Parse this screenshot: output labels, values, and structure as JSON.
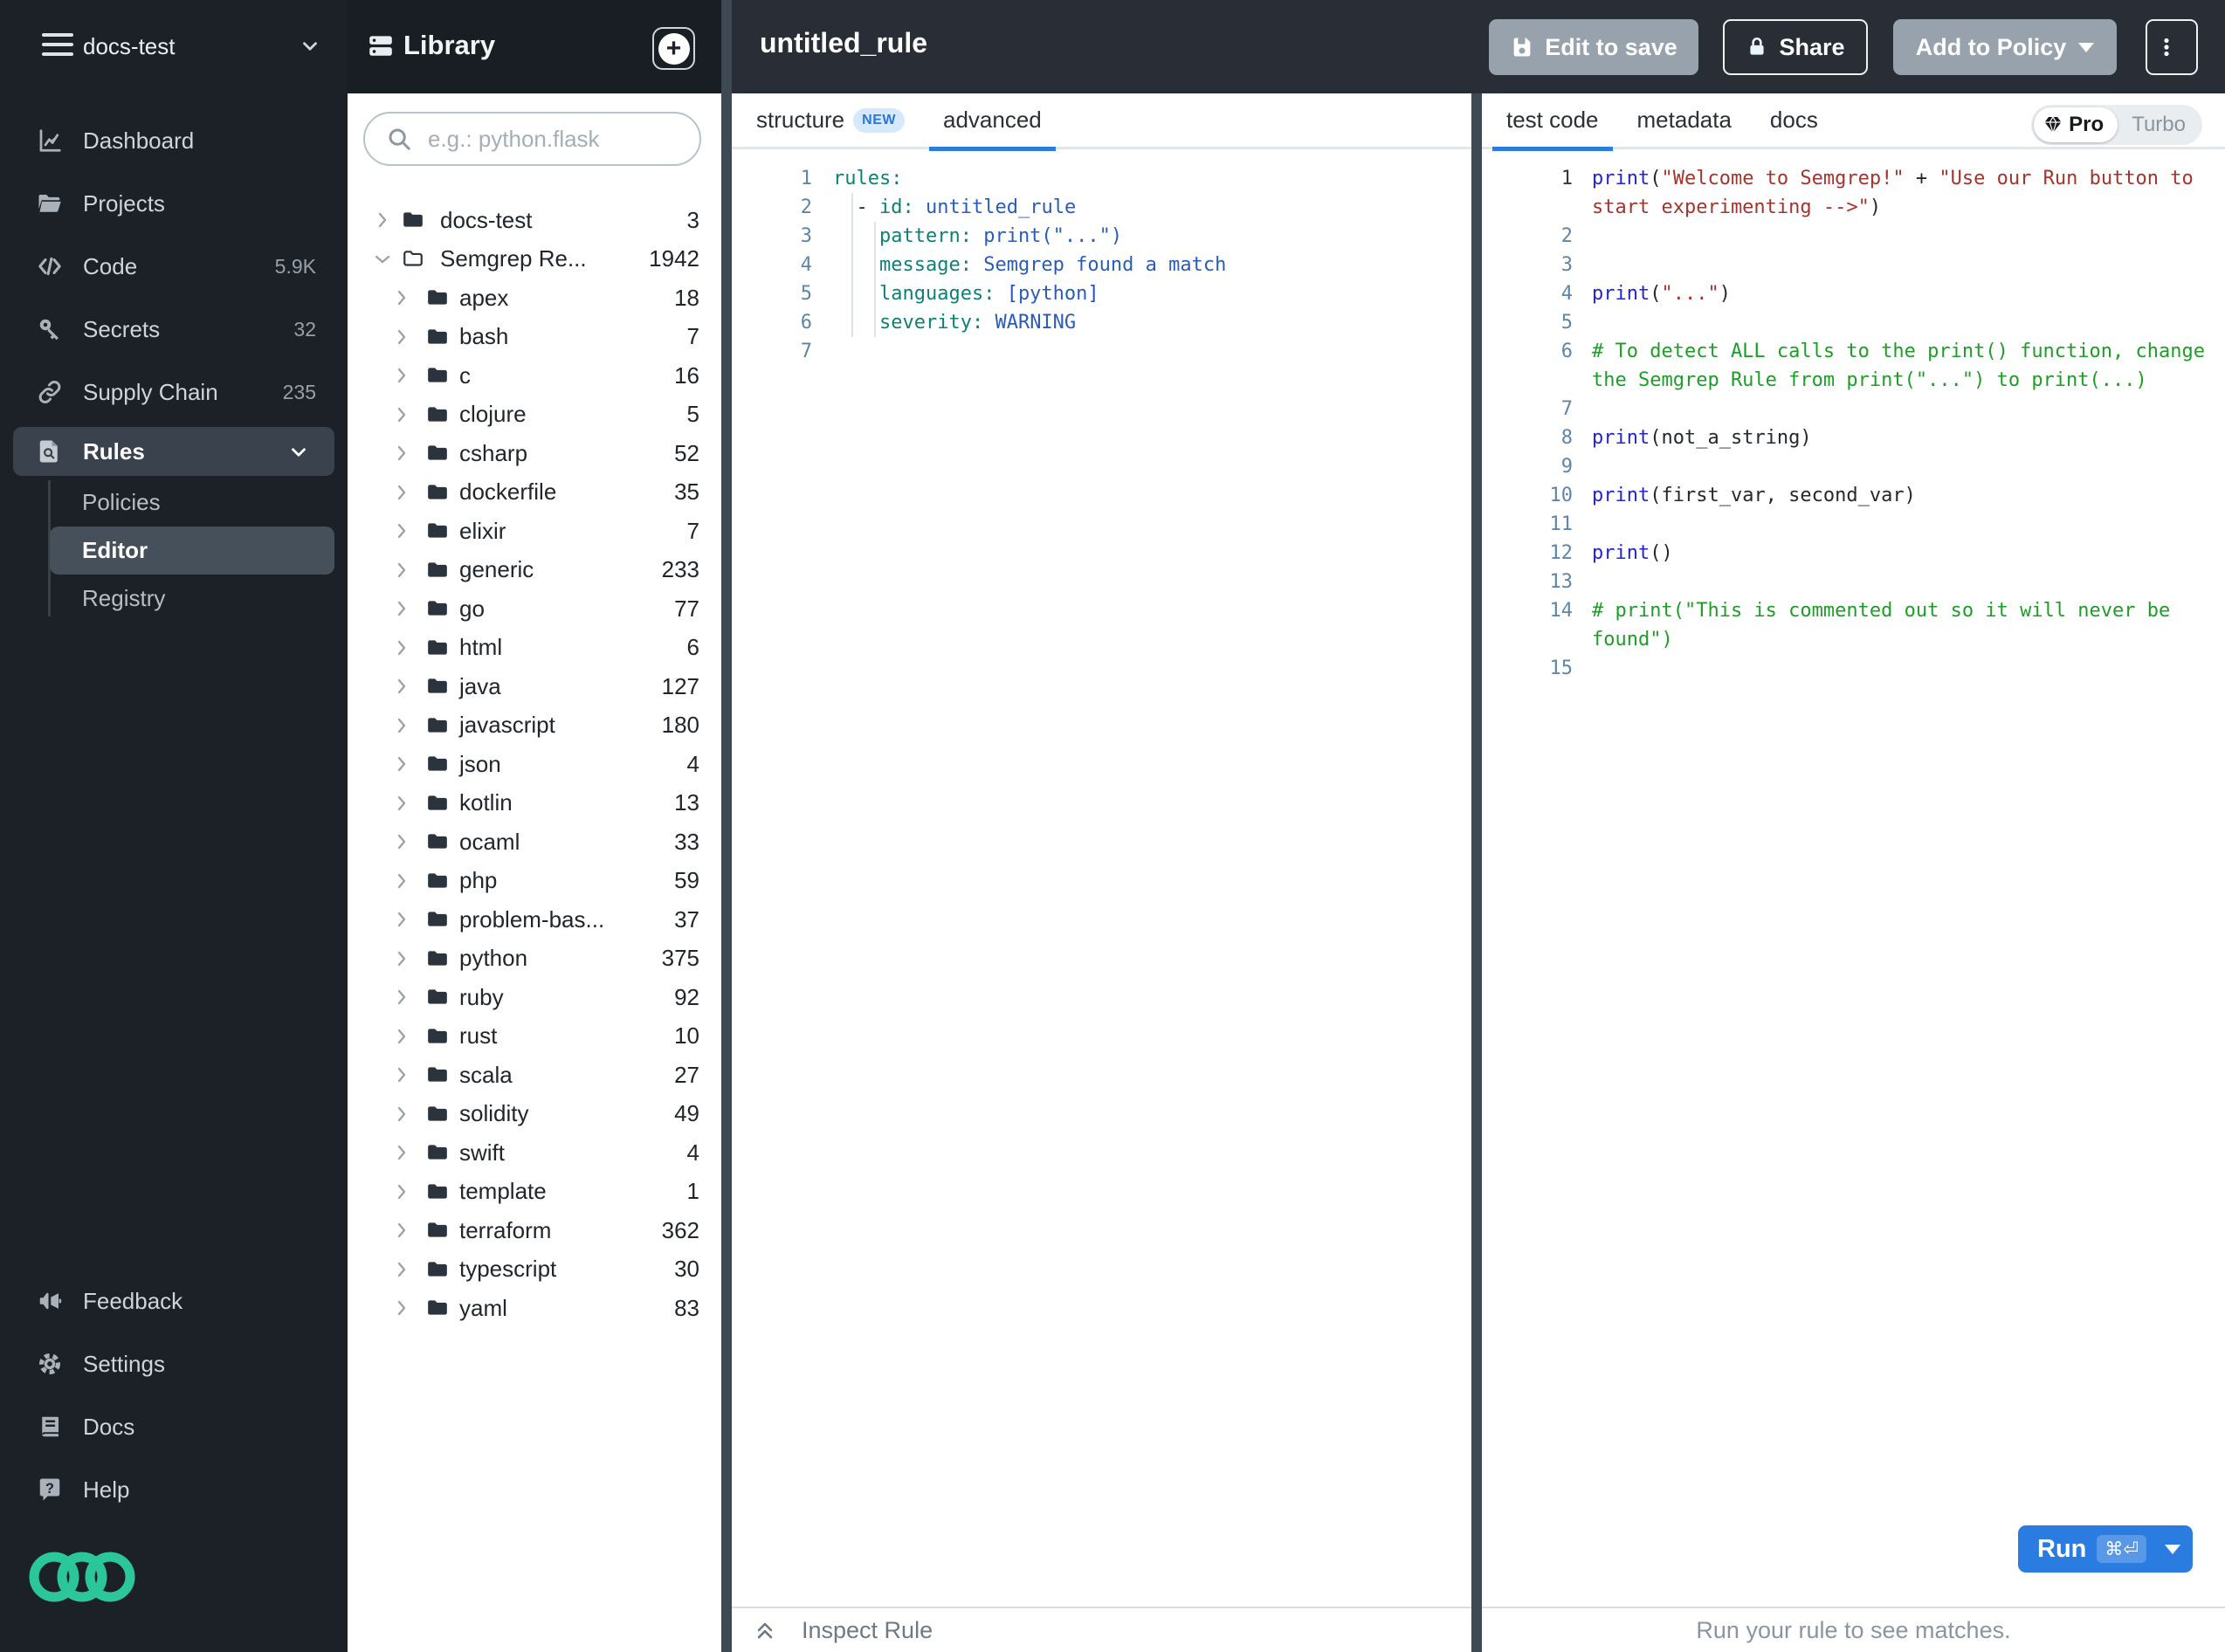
{
  "workspace": {
    "name": "docs-test"
  },
  "sidebar": {
    "nav": [
      {
        "label": "Dashboard"
      },
      {
        "label": "Projects"
      },
      {
        "label": "Code",
        "count": "5.9K"
      },
      {
        "label": "Secrets",
        "count": "32"
      },
      {
        "label": "Supply Chain",
        "count": "235"
      },
      {
        "label": "Rules"
      }
    ],
    "rules_children": [
      {
        "label": "Policies"
      },
      {
        "label": "Editor"
      },
      {
        "label": "Registry"
      }
    ],
    "bottom": [
      {
        "label": "Feedback"
      },
      {
        "label": "Settings"
      },
      {
        "label": "Docs"
      },
      {
        "label": "Help"
      }
    ]
  },
  "library": {
    "title": "Library",
    "search_placeholder": "e.g.: python.flask",
    "tree": [
      {
        "name": "docs-test",
        "count": "3",
        "depth": 0,
        "state": "collapsed",
        "folder": "filled"
      },
      {
        "name": "Semgrep Re...",
        "count": "1942",
        "depth": 0,
        "state": "expanded",
        "folder": "outline"
      },
      {
        "name": "apex",
        "count": "18",
        "depth": 1,
        "state": "collapsed",
        "folder": "filled"
      },
      {
        "name": "bash",
        "count": "7",
        "depth": 1,
        "state": "collapsed",
        "folder": "filled"
      },
      {
        "name": "c",
        "count": "16",
        "depth": 1,
        "state": "collapsed",
        "folder": "filled"
      },
      {
        "name": "clojure",
        "count": "5",
        "depth": 1,
        "state": "collapsed",
        "folder": "filled"
      },
      {
        "name": "csharp",
        "count": "52",
        "depth": 1,
        "state": "collapsed",
        "folder": "filled"
      },
      {
        "name": "dockerfile",
        "count": "35",
        "depth": 1,
        "state": "collapsed",
        "folder": "filled"
      },
      {
        "name": "elixir",
        "count": "7",
        "depth": 1,
        "state": "collapsed",
        "folder": "filled"
      },
      {
        "name": "generic",
        "count": "233",
        "depth": 1,
        "state": "collapsed",
        "folder": "filled"
      },
      {
        "name": "go",
        "count": "77",
        "depth": 1,
        "state": "collapsed",
        "folder": "filled"
      },
      {
        "name": "html",
        "count": "6",
        "depth": 1,
        "state": "collapsed",
        "folder": "filled"
      },
      {
        "name": "java",
        "count": "127",
        "depth": 1,
        "state": "collapsed",
        "folder": "filled"
      },
      {
        "name": "javascript",
        "count": "180",
        "depth": 1,
        "state": "collapsed",
        "folder": "filled"
      },
      {
        "name": "json",
        "count": "4",
        "depth": 1,
        "state": "collapsed",
        "folder": "filled"
      },
      {
        "name": "kotlin",
        "count": "13",
        "depth": 1,
        "state": "collapsed",
        "folder": "filled"
      },
      {
        "name": "ocaml",
        "count": "33",
        "depth": 1,
        "state": "collapsed",
        "folder": "filled"
      },
      {
        "name": "php",
        "count": "59",
        "depth": 1,
        "state": "collapsed",
        "folder": "filled"
      },
      {
        "name": "problem-bas...",
        "count": "37",
        "depth": 1,
        "state": "collapsed",
        "folder": "filled"
      },
      {
        "name": "python",
        "count": "375",
        "depth": 1,
        "state": "collapsed",
        "folder": "filled"
      },
      {
        "name": "ruby",
        "count": "92",
        "depth": 1,
        "state": "collapsed",
        "folder": "filled"
      },
      {
        "name": "rust",
        "count": "10",
        "depth": 1,
        "state": "collapsed",
        "folder": "filled"
      },
      {
        "name": "scala",
        "count": "27",
        "depth": 1,
        "state": "collapsed",
        "folder": "filled"
      },
      {
        "name": "solidity",
        "count": "49",
        "depth": 1,
        "state": "collapsed",
        "folder": "filled"
      },
      {
        "name": "swift",
        "count": "4",
        "depth": 1,
        "state": "collapsed",
        "folder": "filled"
      },
      {
        "name": "template",
        "count": "1",
        "depth": 1,
        "state": "collapsed",
        "folder": "filled"
      },
      {
        "name": "terraform",
        "count": "362",
        "depth": 1,
        "state": "collapsed",
        "folder": "filled"
      },
      {
        "name": "typescript",
        "count": "30",
        "depth": 1,
        "state": "collapsed",
        "folder": "filled"
      },
      {
        "name": "yaml",
        "count": "83",
        "depth": 1,
        "state": "collapsed",
        "folder": "filled"
      }
    ]
  },
  "header": {
    "title": "untitled_rule",
    "edit_to_save": "Edit to save",
    "share": "Share",
    "add_to_policy": "Add to Policy"
  },
  "rule_panel": {
    "tab_structure": "structure",
    "tab_structure_badge": "NEW",
    "tab_advanced": "advanced",
    "inspect_label": "Inspect Rule",
    "code": [
      [
        [
          "key",
          "rules:"
        ]
      ],
      [
        [
          "p",
          "  - "
        ],
        [
          "key",
          "id:"
        ],
        [
          "p",
          " "
        ],
        [
          "val",
          "untitled_rule"
        ]
      ],
      [
        [
          "p",
          "    "
        ],
        [
          "key",
          "pattern:"
        ],
        [
          "p",
          " "
        ],
        [
          "val",
          "print(\"...\")"
        ]
      ],
      [
        [
          "p",
          "    "
        ],
        [
          "key",
          "message:"
        ],
        [
          "p",
          " "
        ],
        [
          "val",
          "Semgrep found a match"
        ]
      ],
      [
        [
          "p",
          "    "
        ],
        [
          "key",
          "languages:"
        ],
        [
          "p",
          " "
        ],
        [
          "brk",
          "["
        ],
        [
          "val",
          "python"
        ],
        [
          "brk",
          "]"
        ]
      ],
      [
        [
          "p",
          "    "
        ],
        [
          "key",
          "severity:"
        ],
        [
          "p",
          " "
        ],
        [
          "val",
          "WARNING"
        ]
      ],
      []
    ]
  },
  "test_panel": {
    "tabs": [
      "test code",
      "metadata",
      "docs"
    ],
    "toggle": {
      "pro": "Pro",
      "turbo": "Turbo"
    },
    "run": {
      "label": "Run",
      "shortcut": "⌘⏎"
    },
    "status": "Run your rule to see matches.",
    "code": [
      [
        [
          "kw",
          "print"
        ],
        [
          "p",
          "("
        ],
        [
          "str",
          "\"Welcome to Semgrep!\""
        ],
        [
          "p",
          " + "
        ],
        [
          "str",
          "\"Use our Run button to start experimenting -->\""
        ],
        [
          "p",
          ")"
        ]
      ],
      [],
      [],
      [
        [
          "kw",
          "print"
        ],
        [
          "p",
          "("
        ],
        [
          "str",
          "\"...\""
        ],
        [
          "p",
          ")"
        ]
      ],
      [],
      [
        [
          "com",
          "# To detect ALL calls to the print() function, change the Semgrep Rule from print(\"...\") to print(...)"
        ]
      ],
      [],
      [
        [
          "kw",
          "print"
        ],
        [
          "p",
          "(not_a_string)"
        ]
      ],
      [],
      [
        [
          "kw",
          "print"
        ],
        [
          "p",
          "(first_var, second_var)"
        ]
      ],
      [],
      [
        [
          "kw",
          "print"
        ],
        [
          "p",
          "()"
        ]
      ],
      [],
      [
        [
          "com",
          "# print(\"This is commented out so it will never be found\")"
        ]
      ],
      []
    ]
  },
  "colors": {
    "accent": "#2b7ce0",
    "logo_green": "#2bc79b",
    "warning_bg": "#98a2ac"
  }
}
